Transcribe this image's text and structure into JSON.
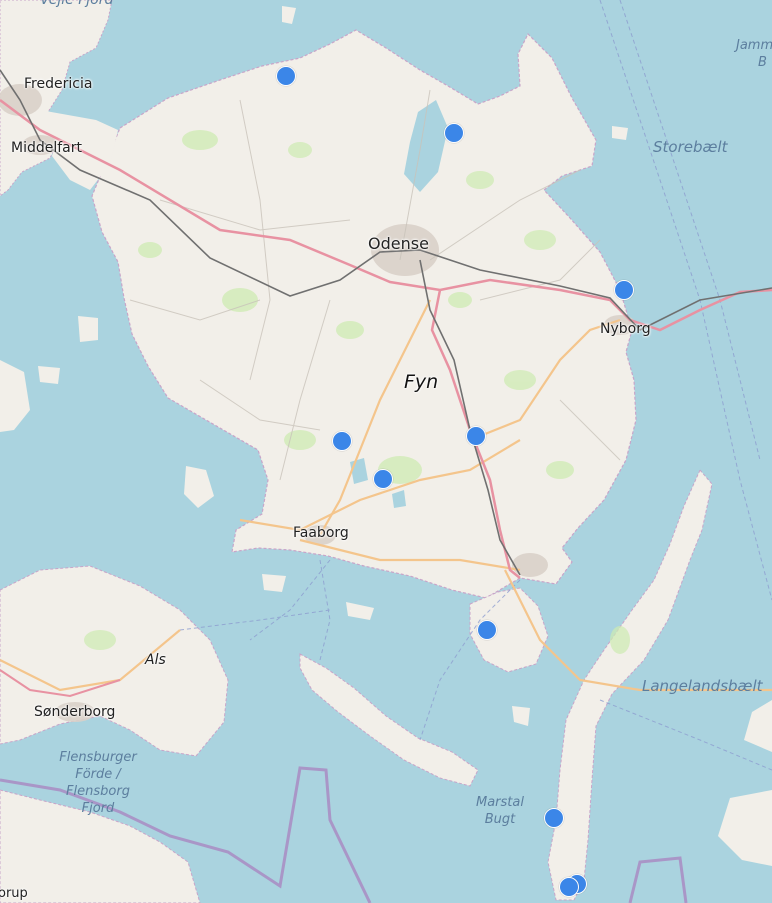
{
  "labels": {
    "vejle_fjord": "Vejle Fjord",
    "fredericia": "Fredericia",
    "middelfart": "Middelfart",
    "odense": "Odense",
    "nyborg": "Nyborg",
    "fyn": "Fyn",
    "faaborg": "Faaborg",
    "als": "Als",
    "sonderborg": "Sønderborg",
    "storebaelt": "Storebælt",
    "langelandsbaelt": "Langelandsbælt",
    "flensburger_1": "Flensburger",
    "flensburger_2": "Förde /",
    "flensburger_3": "Flensborg",
    "flensburger_4": "Fjord",
    "marstal_1": "Marstal",
    "marstal_2": "Bugt",
    "jammer_1": "Jamm",
    "jammer_2": "B",
    "gelting": "orup"
  },
  "markers": {
    "count": 10,
    "color": "#3b86e8"
  },
  "colors": {
    "water": "#aad3df",
    "land": "#f2efe9",
    "motorway": "#e892a2",
    "primary_road": "#fcd6a4",
    "railway": "#707070",
    "border": "#a98fc4"
  }
}
